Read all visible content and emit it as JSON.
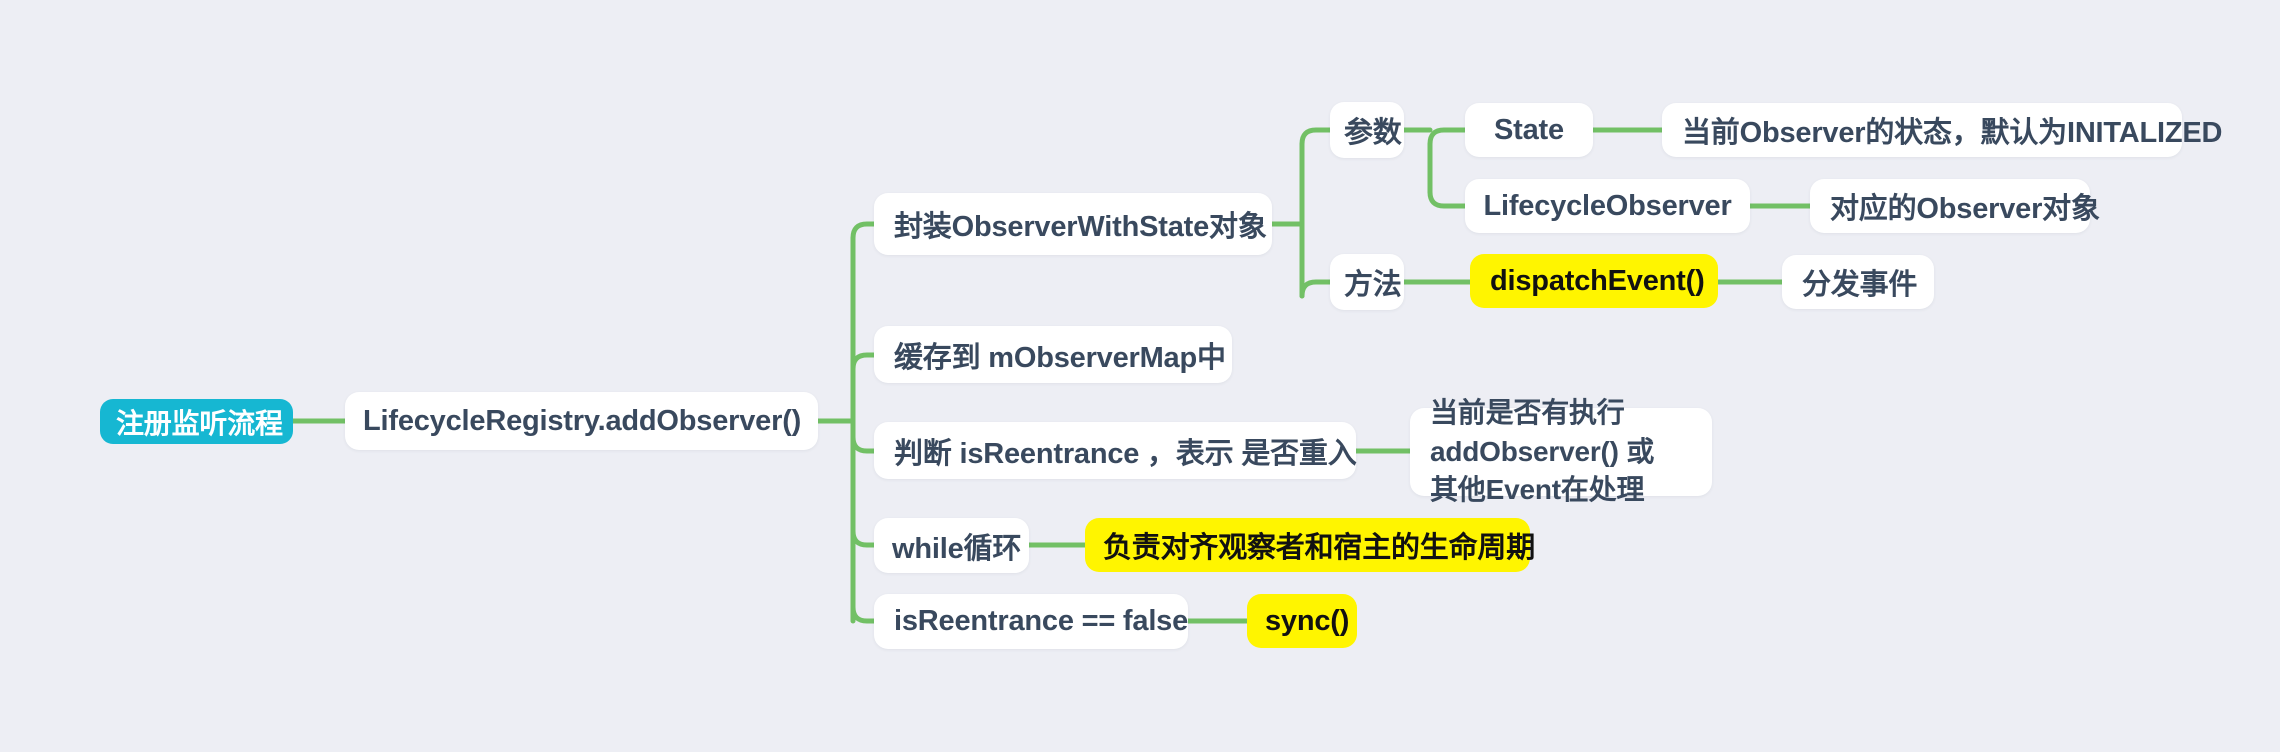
{
  "diagram": {
    "type": "mindmap",
    "background_color": "#edeef4",
    "edge_color": "#72c065",
    "node_fill": "#ffffff",
    "node_text_color": "#39495e",
    "root_fill": "#16b7d2",
    "root_text_color": "#ffffff",
    "highlight_fill": "#fff500",
    "highlight_text_color": "#111111",
    "root": {
      "label": "注册监听流程"
    },
    "level1": {
      "label": "LifecycleRegistry.addObserver()"
    },
    "level2": [
      {
        "label": "封装ObserverWithState对象"
      },
      {
        "label": "缓存到 mObserverMap中"
      },
      {
        "label": "判断 isReentrance ，表示 是否重入"
      },
      {
        "label": "while循环"
      },
      {
        "label": "isReentrance == false"
      }
    ],
    "level3": {
      "params_label": "参数",
      "method_label": "方法",
      "state_label": "State",
      "lifecycle_observer_label": "LifecycleObserver",
      "dispatch_event_label": "dispatchEvent()",
      "reentrance_note_line1": "当前是否有执行addObserver() 或",
      "reentrance_note_line2": "其他Event在处理",
      "while_note_label": "负责对齐观察者和宿主的生命周期",
      "sync_label": "sync()"
    },
    "level4": {
      "state_desc": "当前Observer的状态，默认为INITALIZED",
      "observer_desc": "对应的Observer对象",
      "dispatch_desc": "分发事件"
    }
  }
}
